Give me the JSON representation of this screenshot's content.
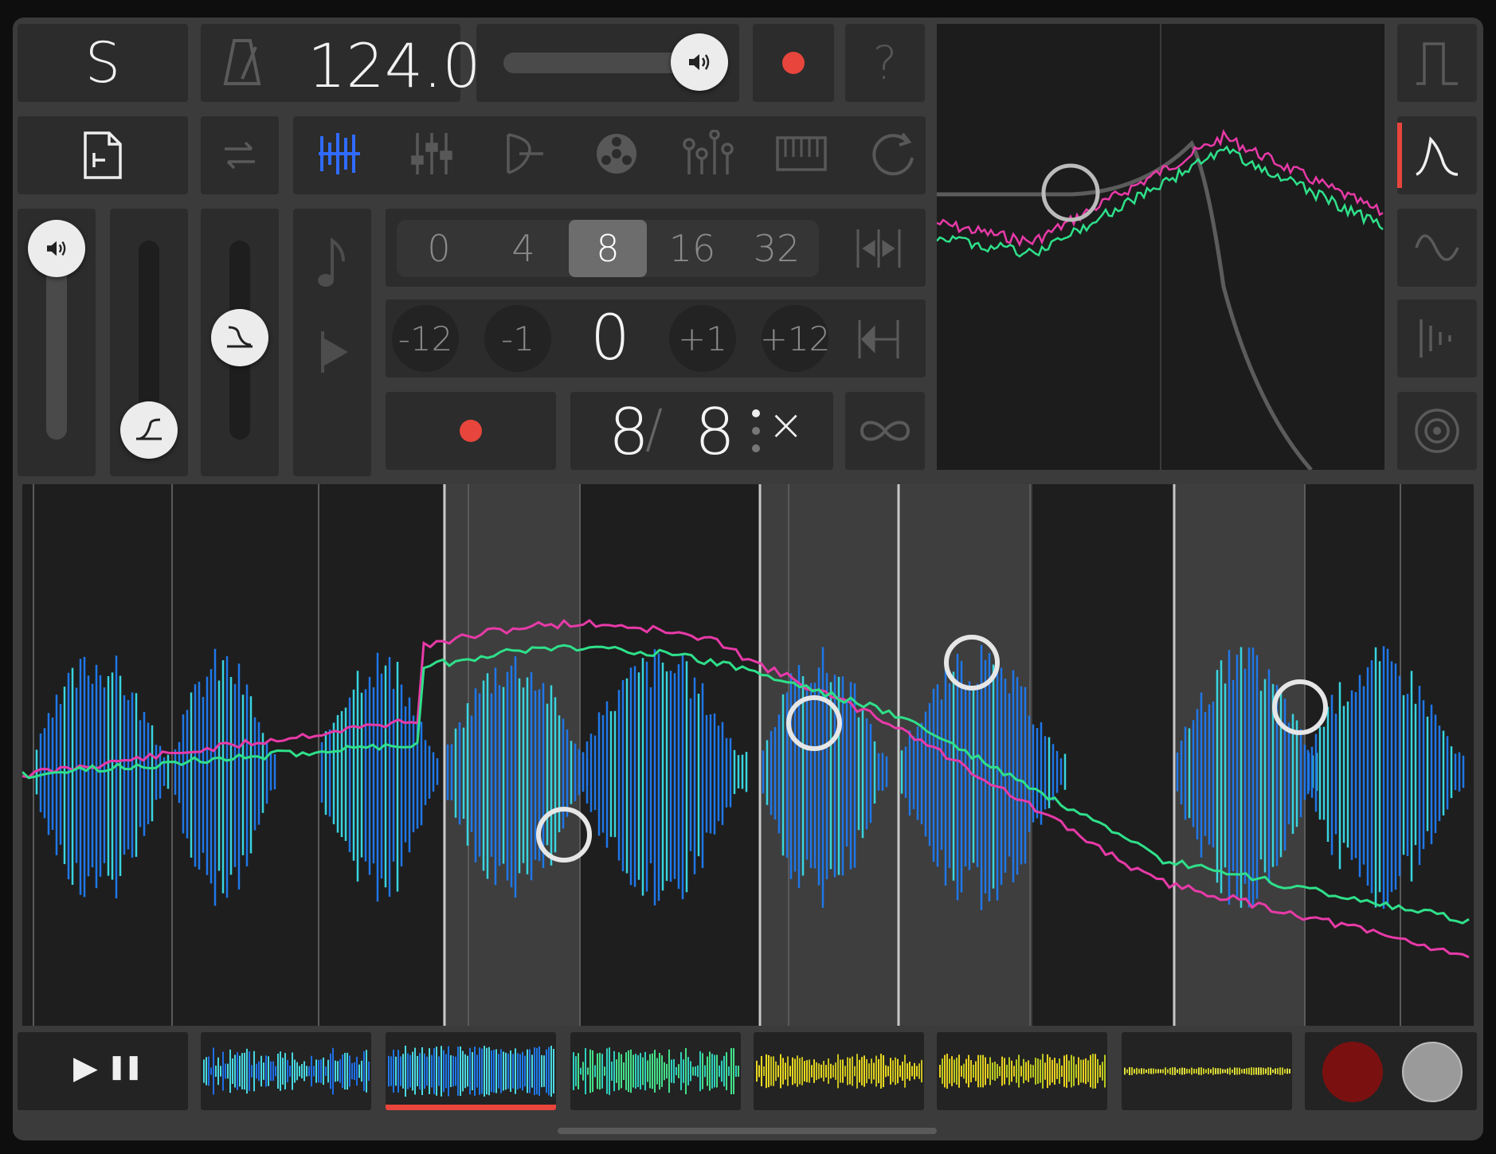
{
  "app": {
    "logo_glyph": "S",
    "tempo": "124.0",
    "help_label": "?"
  },
  "top": {
    "quantize": {
      "options": [
        "0",
        "4",
        "8",
        "16",
        "32"
      ],
      "selected": "8"
    },
    "transpose": {
      "options": [
        "-12",
        "-1",
        "0",
        "+1",
        "+12"
      ],
      "value": "0"
    },
    "loop": {
      "numerator": "8",
      "slash": "/",
      "denominator": "8",
      "clear_label": "×"
    }
  },
  "tabs": [
    {
      "name": "tab-waveform",
      "icon": "waveform-bars-icon",
      "active": true
    },
    {
      "name": "tab-mixer",
      "icon": "mixer-sliders-icon",
      "active": false
    },
    {
      "name": "tab-fx",
      "icon": "fx-icon",
      "active": false
    },
    {
      "name": "tab-tape",
      "icon": "tape-reel-icon",
      "active": false
    },
    {
      "name": "tab-eq",
      "icon": "eq-nodes-icon",
      "active": false
    },
    {
      "name": "tab-keyboard",
      "icon": "keyboard-icon",
      "active": false
    },
    {
      "name": "tab-loop",
      "icon": "loop-icon",
      "active": false
    }
  ],
  "side_shapes": [
    {
      "name": "square-wave-icon",
      "active": false
    },
    {
      "name": "envelope-curve-icon",
      "active": true
    },
    {
      "name": "sine-wave-icon",
      "active": false
    },
    {
      "name": "pulse-bars-icon",
      "active": false
    },
    {
      "name": "target-rings-icon",
      "active": false
    }
  ],
  "colors": {
    "accent_red": "#e8453c",
    "active_blue": "#2f6bff",
    "wave_blue": "#1f77e8",
    "wave_cyan": "#38d4e0",
    "line_pink": "#e83aa8",
    "line_green": "#2fe08a"
  },
  "transport": {
    "play_label": "▶",
    "pause_label": "❚❚"
  },
  "clips": [
    {
      "name": "clip-1",
      "colors": [
        "#1e6fe8",
        "#48d7e0"
      ],
      "active": false
    },
    {
      "name": "clip-2",
      "colors": [
        "#1e78e8",
        "#4ad9e2"
      ],
      "active": true
    },
    {
      "name": "clip-3",
      "colors": [
        "#2fd0c0",
        "#44e08a"
      ],
      "active": false
    },
    {
      "name": "clip-4",
      "colors": [
        "#c8c020",
        "#e8d820"
      ],
      "active": false
    },
    {
      "name": "clip-5",
      "colors": [
        "#b8c820",
        "#e8d020"
      ],
      "active": false
    },
    {
      "name": "clip-6",
      "colors": [
        "#c8c828",
        "#e0e040"
      ],
      "active": false
    }
  ]
}
